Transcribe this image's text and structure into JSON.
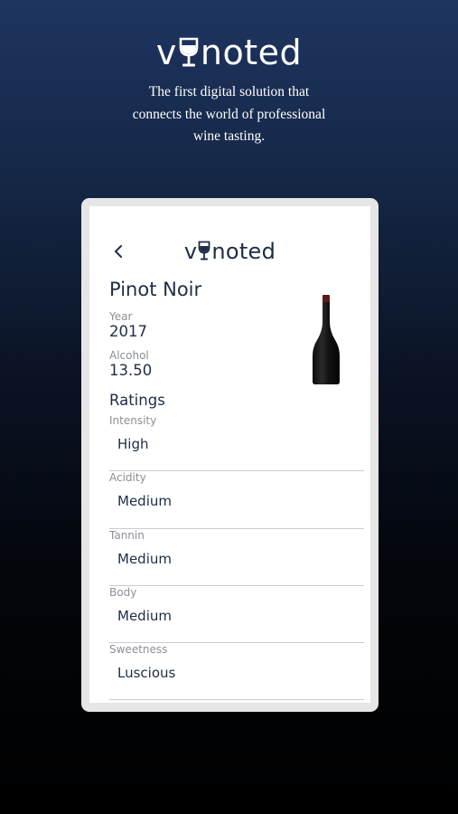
{
  "hero": {
    "logo_prefix": "v",
    "logo_suffix": "noted",
    "tagline_lines": [
      "The first digital solution that",
      "connects the world of professional",
      "wine tasting."
    ]
  },
  "app": {
    "back_icon": "chevron-left-icon",
    "logo_prefix": "v",
    "logo_suffix": "noted"
  },
  "wine": {
    "name": "Pinot Noir",
    "year_label": "Year",
    "year": "2017",
    "alcohol_label": "Alcohol",
    "alcohol": "13.50",
    "bottle_icon": "wine-bottle-icon"
  },
  "ratings": {
    "title": "Ratings",
    "items": [
      {
        "label": "Intensity",
        "value": "High"
      },
      {
        "label": "Acidity",
        "value": "Medium"
      },
      {
        "label": "Tannin",
        "value": "Medium"
      },
      {
        "label": "Body",
        "value": "Medium"
      },
      {
        "label": "Sweetness",
        "value": "Luscious"
      }
    ]
  },
  "colors": {
    "background_top": "#1e3560",
    "background_bottom": "#000000",
    "brand_navy": "#1f2d44",
    "frame": "#e6e6e6"
  }
}
